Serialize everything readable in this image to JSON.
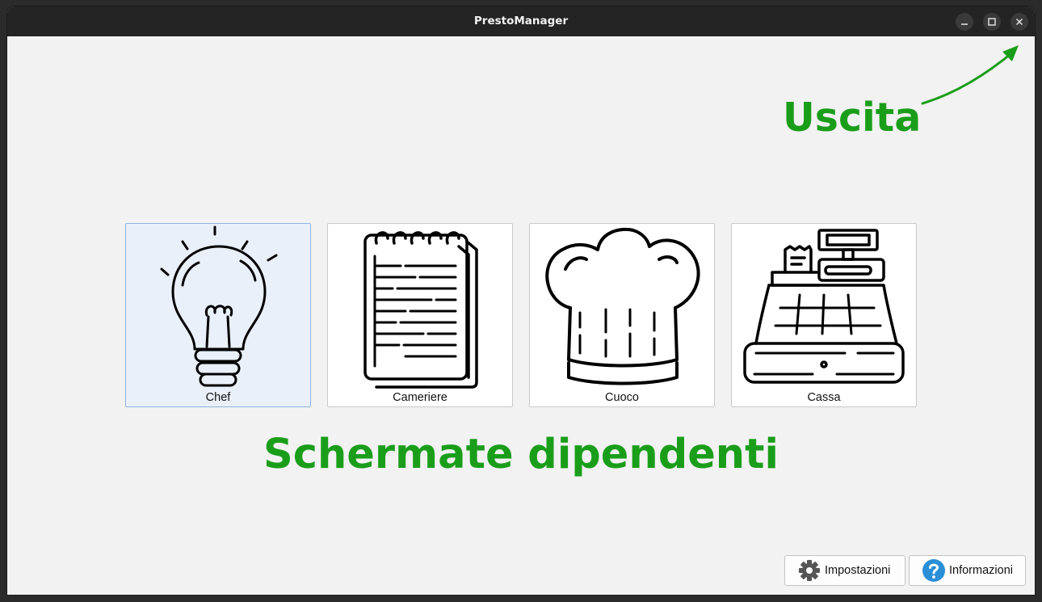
{
  "window": {
    "title": "PrestoManager",
    "controls": [
      "minimize-icon",
      "maximize-icon",
      "close-icon"
    ]
  },
  "annotations": {
    "exit_label": "Uscita",
    "screens_label": "Schermate dipendenti",
    "color": "#1a9e1a"
  },
  "tiles": [
    {
      "label": "Chef",
      "icon": "lightbulb-icon",
      "selected": true
    },
    {
      "label": "Cameriere",
      "icon": "notepad-icon",
      "selected": false
    },
    {
      "label": "Cuoco",
      "icon": "chef-hat-icon",
      "selected": false
    },
    {
      "label": "Cassa",
      "icon": "cash-register-icon",
      "selected": false
    }
  ],
  "footer": {
    "settings_label": "Impostazioni",
    "info_label": "Informazioni"
  },
  "colors": {
    "titlebar": "#242424",
    "background": "#f2f2f2",
    "selected_tile": "#e9f0fa",
    "info_icon": "#2a8fd6"
  }
}
